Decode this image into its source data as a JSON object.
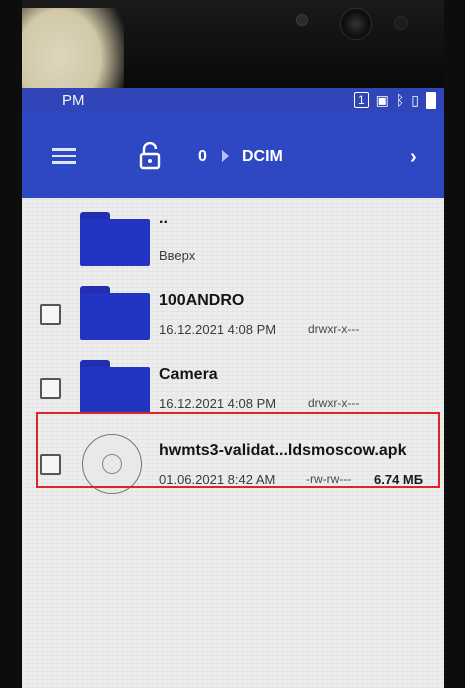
{
  "status_bar": {
    "time": "PM",
    "sim_slot": "1",
    "icons": [
      "sim-card-icon",
      "screenshot-icon",
      "bluetooth-icon",
      "vibrate-icon",
      "battery-icon"
    ]
  },
  "toolbar": {
    "root_label": "0",
    "current_folder": "DCIM",
    "menu_icon": "hamburger-menu-icon",
    "lock_icon": "unlock-icon",
    "forward_icon": "chevron-right-icon"
  },
  "files": [
    {
      "name": "..",
      "subtitle": "Вверх",
      "type": "folder"
    },
    {
      "name": "100ANDRO",
      "date": "16.12.2021 4:08 PM",
      "permissions": "drwxr-x---",
      "type": "folder"
    },
    {
      "name": "Camera",
      "date": "16.12.2021 4:08 PM",
      "permissions": "drwxr-x---",
      "type": "folder"
    },
    {
      "name": "hwmts3-validat...ldsmoscow.apk",
      "date": "01.06.2021 8:42 AM",
      "permissions": "-rw-rw---",
      "size": "6.74 МБ",
      "type": "apk"
    }
  ],
  "colors": {
    "app_bar": "#2e47c2",
    "status_bar": "#2f45b8",
    "folder": "#2235c2",
    "highlight": "#e0252a"
  }
}
